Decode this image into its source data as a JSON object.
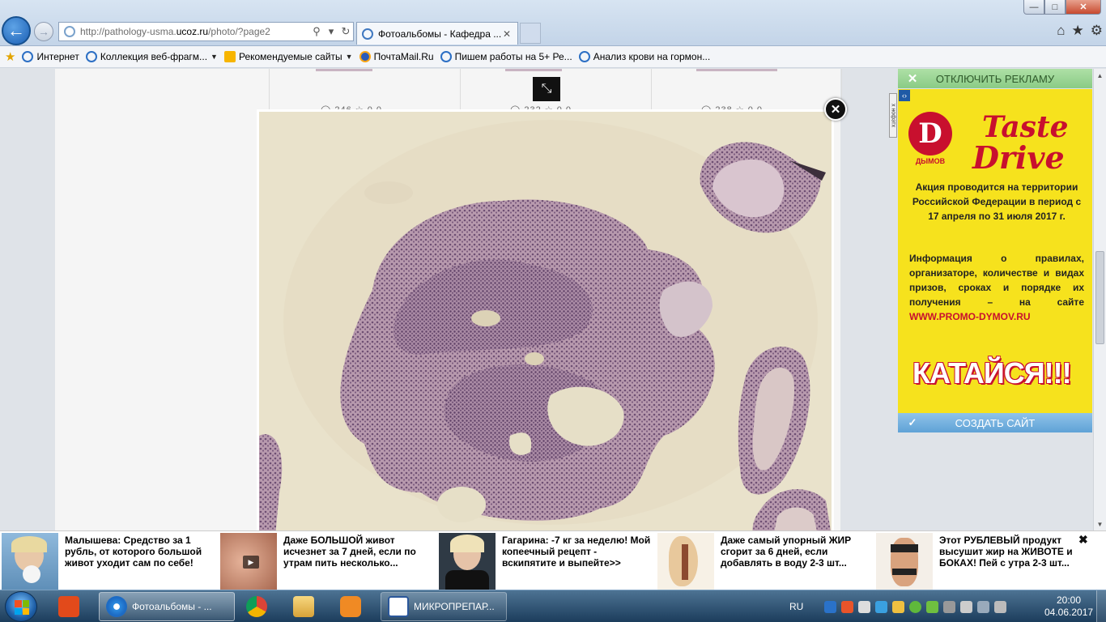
{
  "browser": {
    "address_prefix": "http://pathology-usma.",
    "address_domain": "ucoz.ru",
    "address_path": "/photo/?page2",
    "tab_title": "Фотоальбомы - Кафедра ...",
    "search_glyph": "⚲",
    "refresh_glyph": "↻",
    "back_glyph": "←",
    "forward_glyph": "→",
    "home_glyph": "⌂",
    "favorites_glyph": "★",
    "tools_glyph": "⚙",
    "min_glyph": "—",
    "max_glyph": "□",
    "close_glyph": "✕"
  },
  "favorites": [
    {
      "label": "Интернет",
      "icon": "ie-icon",
      "dropdown": false
    },
    {
      "label": "Коллекция веб-фрагм...",
      "icon": "ie-icon",
      "dropdown": true
    },
    {
      "label": "Рекомендуемые сайты",
      "icon": "bing-icon",
      "dropdown": true
    },
    {
      "label": "ПочтаMail.Ru",
      "icon": "mail-icon",
      "dropdown": false
    },
    {
      "label": "Пишем работы на 5+   Ре...",
      "icon": "ie-icon",
      "dropdown": false
    },
    {
      "label": "Анализ крови на гормон...",
      "icon": "ie-icon",
      "dropdown": false
    }
  ],
  "lightbox": {
    "expand_glyph": "⤡",
    "close_glyph": "✕"
  },
  "thumbs": [
    {
      "stats": "◯ 246  ☆ 0.0"
    },
    {
      "stats": "◯ 232  ☆ 0.0"
    },
    {
      "stats": "◯ 238  ☆ 0.0"
    }
  ],
  "ad": {
    "disable_label": "ОТКЛЮЧИТЬ РЕКЛАМУ",
    "disable_glyph": "✕",
    "side_tag": "х нофэтх",
    "brand_letter": "D",
    "brand_name": "ДЫМОВ",
    "headline_1": "Taste",
    "headline_2": "Drive",
    "promo_text": "Акция проводится на территории Российской Федерации в период с 17 апреля по 31 июля 2017 г.",
    "info_text": "Информация о правилах, организаторе, количестве и видах призов, сроках и порядке их получения – на сайте",
    "info_url": "WWW.PROMO-DYMOV.RU",
    "cta": "КАТАЙСЯ!!!",
    "create_label": "СОЗДАТЬ САЙТ",
    "create_glyph": "✓"
  },
  "ticker": [
    {
      "text": "Малышева: Средство за 1 рубль, от которого большой живот уходит сам по себе!",
      "video": false
    },
    {
      "text": "Даже БОЛЬШОЙ живот исчезнет за 7 дней, если по утрам пить несколько...",
      "video": true
    },
    {
      "text": "Гагарина: -7 кг за неделю! Мой копеечный рецепт - вскипятите и выпейте>>",
      "video": false
    },
    {
      "text": "Даже самый упорный ЖИР сгорит за 6 дней, если добавлять в воду 2-3 шт...",
      "video": false
    },
    {
      "text": "Этот РУБЛЕВЫЙ продукт высушит жир на ЖИВОТЕ и БОКАХ! Пей с утра 2-3 шт...",
      "video": false
    }
  ],
  "ticker_close": "✖",
  "taskbar": {
    "ie_window": "Фотоальбомы - ...",
    "word_window": "МИКРОПРЕПАР...",
    "lang": "RU",
    "time": "20:00",
    "date": "04.06.2017"
  }
}
